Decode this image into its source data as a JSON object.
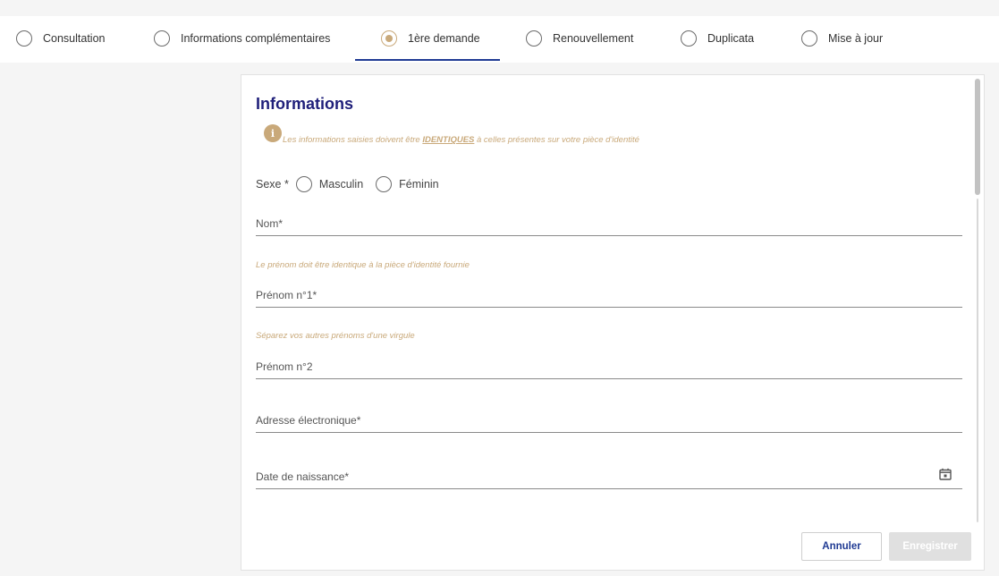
{
  "tabs": [
    {
      "label": "Consultation",
      "active": false
    },
    {
      "label": "Informations complémentaires",
      "active": false
    },
    {
      "label": "1ère demande",
      "active": true
    },
    {
      "label": "Renouvellement",
      "active": false
    },
    {
      "label": "Duplicata",
      "active": false
    },
    {
      "label": "Mise à jour",
      "active": false
    }
  ],
  "form": {
    "title": "Informations",
    "info_prefix": "Les informations saisies doivent être ",
    "info_emphasis": "IDENTIQUES",
    "info_suffix": " à celles présentes sur votre pièce d'identité",
    "sexe_label": "Sexe *",
    "sexe_options": [
      "Masculin",
      "Féminin"
    ],
    "fields": {
      "nom": "Nom*",
      "prenom1": "Prénom n°1*",
      "prenom2": "Prénom n°2",
      "email": "Adresse électronique*",
      "birthdate": "Date de naissance*"
    },
    "hints": {
      "prenom1": "Le prénom doit être identique à la pièce d'identité fournie",
      "prenom2": "Séparez vos autres prénoms d'une virgule"
    }
  },
  "buttons": {
    "cancel": "Annuler",
    "save": "Enregistrer"
  },
  "colors": {
    "accent_gold": "#c9a97a",
    "title_navy": "#1f1f7a",
    "tab_underline": "#1f3a93"
  },
  "icons": {
    "info": "info-icon",
    "calendar": "calendar-icon"
  }
}
